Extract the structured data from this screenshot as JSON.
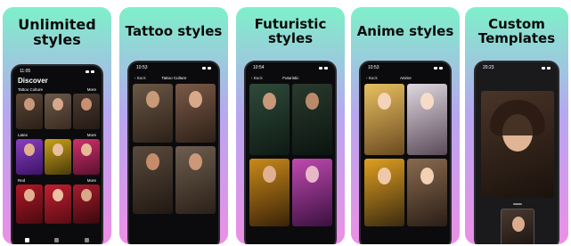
{
  "cards": [
    {
      "title": "Unlimited styles",
      "screen": {
        "time": "11:05",
        "heading": "Discover",
        "sections": [
          {
            "label": "Tattoo Culture",
            "more": "More"
          },
          {
            "label": "Latex",
            "more": "More"
          },
          {
            "label": "Red",
            "more": "More"
          }
        ]
      }
    },
    {
      "title": "Tattoo styles",
      "screen": {
        "time": "10:53",
        "back": "Back",
        "nav_title": "Tattoo Culture"
      }
    },
    {
      "title": "Futuristic styles",
      "screen": {
        "time": "10:54",
        "back": "Back",
        "nav_title": "Futuristic"
      }
    },
    {
      "title": "Anime styles",
      "screen": {
        "time": "10:53",
        "back": "Back",
        "nav_title": "Anime"
      }
    },
    {
      "title": "Custom Templates",
      "screen": {
        "time": "20:23"
      }
    }
  ],
  "colors": {
    "gradient_top": "#7ef0c9",
    "gradient_mid": "#b7a7f0",
    "gradient_bottom": "#ec8fe6",
    "phone_bg": "#0b0b0d"
  }
}
